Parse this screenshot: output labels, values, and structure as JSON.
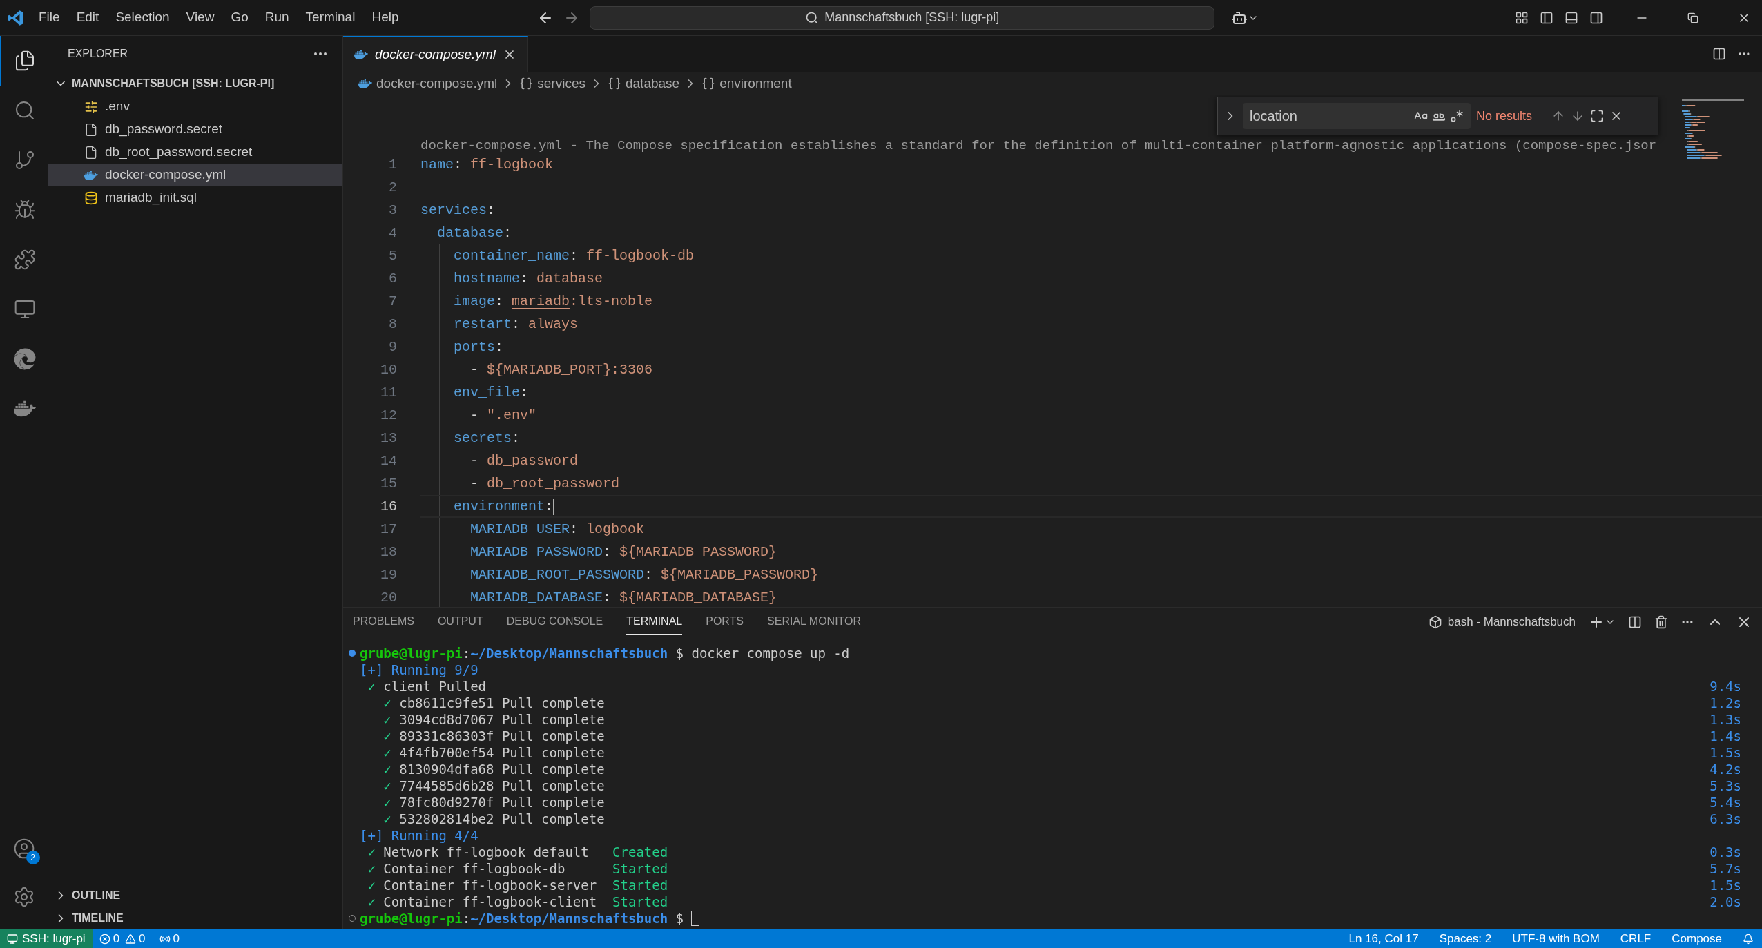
{
  "title_bar": {
    "menu": [
      "File",
      "Edit",
      "Selection",
      "View",
      "Go",
      "Run",
      "Terminal",
      "Help"
    ],
    "search": "Mannschaftsbuch [SSH: lugr-pi]"
  },
  "activity_bar": {
    "items": [
      {
        "kind": "files",
        "selected": true
      },
      {
        "kind": "search",
        "selected": false
      },
      {
        "kind": "source-control",
        "selected": false
      },
      {
        "kind": "debug",
        "selected": false
      },
      {
        "kind": "extensions",
        "selected": false
      },
      {
        "kind": "remote",
        "selected": false
      },
      {
        "kind": "edge",
        "selected": false
      },
      {
        "kind": "docker",
        "selected": false
      }
    ],
    "account_badge": "2"
  },
  "sidebar": {
    "title": "EXPLORER",
    "folder": {
      "label": "MANNSCHAFTSBUCH [SSH: LUGR-PI]",
      "expanded": true,
      "children": [
        {
          "label": ".env",
          "kind": "env",
          "selected": false
        },
        {
          "label": "db_password.secret",
          "kind": "file",
          "selected": false
        },
        {
          "label": "db_root_password.secret",
          "kind": "file",
          "selected": false
        },
        {
          "label": "docker-compose.yml",
          "kind": "docker",
          "selected": true
        },
        {
          "label": "mariadb_init.sql",
          "kind": "database",
          "selected": false
        }
      ]
    },
    "sections": [
      {
        "label": "OUTLINE",
        "expanded": false
      },
      {
        "label": "TIMELINE",
        "expanded": false
      }
    ]
  },
  "editor": {
    "tabs": [
      {
        "label": "docker-compose.yml",
        "selected": true,
        "preview": true
      }
    ],
    "breadcrumb": [
      {
        "label": "docker-compose.yml",
        "kind": "file"
      },
      {
        "label": "services",
        "kind": "object"
      },
      {
        "label": "database",
        "kind": "object"
      },
      {
        "label": "environment",
        "kind": "object"
      }
    ],
    "find": {
      "value": "location",
      "result": "No results"
    },
    "codelens": "docker-compose.yml - The Compose specification establishes a standard for the definition of multi-container platform-agnostic applications (compose-spec.jsor",
    "lines": [
      {
        "number": "1",
        "current": false,
        "tokens": [
          {
            "kind": "key",
            "text": "name"
          },
          {
            "kind": "punct",
            "text": ": "
          },
          {
            "kind": "value",
            "text": "ff-logbook"
          }
        ]
      },
      {
        "number": "2",
        "current": false
      },
      {
        "number": "3",
        "current": false,
        "tokens": [
          {
            "kind": "key",
            "text": "services"
          },
          {
            "kind": "punct",
            "text": ":"
          }
        ]
      },
      {
        "number": "4",
        "current": false,
        "tokens": [
          {
            "kind": "key",
            "text": "  database"
          },
          {
            "kind": "punct",
            "text": ":"
          }
        ]
      },
      {
        "number": "5",
        "current": false,
        "tokens": [
          {
            "kind": "key",
            "text": "    container_name"
          },
          {
            "kind": "punct",
            "text": ": "
          },
          {
            "kind": "value",
            "text": "ff-logbook-db"
          }
        ]
      },
      {
        "number": "6",
        "current": false,
        "tokens": [
          {
            "kind": "key",
            "text": "    hostname"
          },
          {
            "kind": "punct",
            "text": ": "
          },
          {
            "kind": "value",
            "text": "database"
          }
        ]
      },
      {
        "number": "7",
        "current": false,
        "tokens": [
          {
            "kind": "key",
            "text": "    image"
          },
          {
            "kind": "punct",
            "text": ": "
          },
          {
            "kind": "link",
            "text": "mariadb"
          },
          {
            "kind": "value",
            "text": ":lts-noble"
          }
        ]
      },
      {
        "number": "8",
        "current": false,
        "tokens": [
          {
            "kind": "key",
            "text": "    restart"
          },
          {
            "kind": "punct",
            "text": ": "
          },
          {
            "kind": "value",
            "text": "always"
          }
        ]
      },
      {
        "number": "9",
        "current": false,
        "tokens": [
          {
            "kind": "key",
            "text": "    ports"
          },
          {
            "kind": "punct",
            "text": ":"
          }
        ]
      },
      {
        "number": "10",
        "current": false,
        "tokens": [
          {
            "kind": "punct",
            "text": "      - "
          },
          {
            "kind": "value",
            "text": "${MARIADB_PORT}:3306"
          }
        ]
      },
      {
        "number": "11",
        "current": false,
        "tokens": [
          {
            "kind": "key",
            "text": "    env_file"
          },
          {
            "kind": "punct",
            "text": ":"
          }
        ]
      },
      {
        "number": "12",
        "current": false,
        "tokens": [
          {
            "kind": "punct",
            "text": "      - "
          },
          {
            "kind": "value",
            "text": "\".env\""
          }
        ]
      },
      {
        "number": "13",
        "current": false,
        "tokens": [
          {
            "kind": "key",
            "text": "    secrets"
          },
          {
            "kind": "punct",
            "text": ":"
          }
        ]
      },
      {
        "number": "14",
        "current": false,
        "tokens": [
          {
            "kind": "punct",
            "text": "      - "
          },
          {
            "kind": "value",
            "text": "db_password"
          }
        ]
      },
      {
        "number": "15",
        "current": false,
        "tokens": [
          {
            "kind": "punct",
            "text": "      - "
          },
          {
            "kind": "value",
            "text": "db_root_password"
          }
        ]
      },
      {
        "number": "16",
        "current": true,
        "tokens": [
          {
            "kind": "key",
            "text": "    environment"
          },
          {
            "kind": "punct",
            "text": ":"
          }
        ]
      },
      {
        "number": "17",
        "current": false,
        "tokens": [
          {
            "kind": "key",
            "text": "      MARIADB_USER"
          },
          {
            "kind": "punct",
            "text": ": "
          },
          {
            "kind": "value",
            "text": "logbook"
          }
        ]
      },
      {
        "number": "18",
        "current": false,
        "tokens": [
          {
            "kind": "key",
            "text": "      MARIADB_PASSWORD"
          },
          {
            "kind": "punct",
            "text": ": "
          },
          {
            "kind": "value",
            "text": "${MARIADB_PASSWORD}"
          }
        ]
      },
      {
        "number": "19",
        "current": false,
        "tokens": [
          {
            "kind": "key",
            "text": "      MARIADB_ROOT_PASSWORD"
          },
          {
            "kind": "punct",
            "text": ": "
          },
          {
            "kind": "value",
            "text": "${MARIADB_PASSWORD}"
          }
        ]
      },
      {
        "number": "20",
        "current": false,
        "tokens": [
          {
            "kind": "key",
            "text": "      MARIADB_DATABASE"
          },
          {
            "kind": "punct",
            "text": ": "
          },
          {
            "kind": "value",
            "text": "${MARIADB_DATABASE}"
          }
        ]
      }
    ]
  },
  "panel": {
    "tabs": [
      {
        "label": "PROBLEMS",
        "selected": false
      },
      {
        "label": "OUTPUT",
        "selected": false
      },
      {
        "label": "DEBUG CONSOLE",
        "selected": false
      },
      {
        "label": "TERMINAL",
        "selected": true
      },
      {
        "label": "PORTS",
        "selected": false
      },
      {
        "label": "SERIAL MONITOR",
        "selected": false
      }
    ],
    "terminal_name": "bash - Mannschaftsbuch",
    "lines": [
      {
        "succeeded": true,
        "tokens": [
          {
            "kind": "user",
            "text": "grube@lugr-pi"
          },
          {
            "kind": "plain",
            "text": ":"
          },
          {
            "kind": "path",
            "text": "~/Desktop/Mannschaftsbuch"
          },
          {
            "kind": "plain",
            "text": " $ docker compose up -d"
          }
        ]
      },
      {
        "tokens": [
          {
            "kind": "info",
            "text": "[+] Running 9/9"
          }
        ]
      },
      {
        "tokens": [
          {
            "kind": "check",
            "text": " ✓ "
          },
          {
            "kind": "plain",
            "text": "client Pulled"
          }
        ],
        "time": "9.4s"
      },
      {
        "tokens": [
          {
            "kind": "check",
            "text": "   ✓ "
          },
          {
            "kind": "plain",
            "text": "cb8611c9fe51 Pull complete"
          }
        ],
        "time": "1.2s"
      },
      {
        "tokens": [
          {
            "kind": "check",
            "text": "   ✓ "
          },
          {
            "kind": "plain",
            "text": "3094cd8d7067 Pull complete"
          }
        ],
        "time": "1.3s"
      },
      {
        "tokens": [
          {
            "kind": "check",
            "text": "   ✓ "
          },
          {
            "kind": "plain",
            "text": "89331c86303f Pull complete"
          }
        ],
        "time": "1.4s"
      },
      {
        "tokens": [
          {
            "kind": "check",
            "text": "   ✓ "
          },
          {
            "kind": "plain",
            "text": "4f4fb700ef54 Pull complete"
          }
        ],
        "time": "1.5s"
      },
      {
        "tokens": [
          {
            "kind": "check",
            "text": "   ✓ "
          },
          {
            "kind": "plain",
            "text": "8130904dfa68 Pull complete"
          }
        ],
        "time": "4.2s"
      },
      {
        "tokens": [
          {
            "kind": "check",
            "text": "   ✓ "
          },
          {
            "kind": "plain",
            "text": "7744585d6b28 Pull complete"
          }
        ],
        "time": "5.3s"
      },
      {
        "tokens": [
          {
            "kind": "check",
            "text": "   ✓ "
          },
          {
            "kind": "plain",
            "text": "78fc80d9270f Pull complete"
          }
        ],
        "time": "5.4s"
      },
      {
        "tokens": [
          {
            "kind": "check",
            "text": "   ✓ "
          },
          {
            "kind": "plain",
            "text": "532802814be2 Pull complete"
          }
        ],
        "time": "6.3s"
      },
      {
        "tokens": [
          {
            "kind": "info",
            "text": "[+] Running 4/4"
          }
        ]
      },
      {
        "tokens": [
          {
            "kind": "check",
            "text": " ✓ "
          },
          {
            "kind": "plain",
            "text": "Network ff-logbook_default   "
          },
          {
            "kind": "status",
            "text": "Created"
          }
        ],
        "time": "0.3s"
      },
      {
        "tokens": [
          {
            "kind": "check",
            "text": " ✓ "
          },
          {
            "kind": "plain",
            "text": "Container ff-logbook-db      "
          },
          {
            "kind": "status",
            "text": "Started"
          }
        ],
        "time": "5.7s"
      },
      {
        "tokens": [
          {
            "kind": "check",
            "text": " ✓ "
          },
          {
            "kind": "plain",
            "text": "Container ff-logbook-server  "
          },
          {
            "kind": "status",
            "text": "Started"
          }
        ],
        "time": "1.5s"
      },
      {
        "tokens": [
          {
            "kind": "check",
            "text": " ✓ "
          },
          {
            "kind": "plain",
            "text": "Container ff-logbook-client  "
          },
          {
            "kind": "status",
            "text": "Started"
          }
        ],
        "time": "2.0s"
      },
      {
        "succeeded": false,
        "cursor": true,
        "tokens": [
          {
            "kind": "user",
            "text": "grube@lugr-pi"
          },
          {
            "kind": "plain",
            "text": ":"
          },
          {
            "kind": "path",
            "text": "~/Desktop/Mannschaftsbuch"
          },
          {
            "kind": "plain",
            "text": " $ "
          }
        ]
      }
    ]
  },
  "status_bar": {
    "remote": "SSH: lugr-pi",
    "errors": "0",
    "warnings": "0",
    "ports": "0",
    "right": [
      "Ln 16, Col 17",
      "Spaces: 2",
      "UTF-8 with BOM",
      "CRLF",
      "Compose"
    ]
  }
}
